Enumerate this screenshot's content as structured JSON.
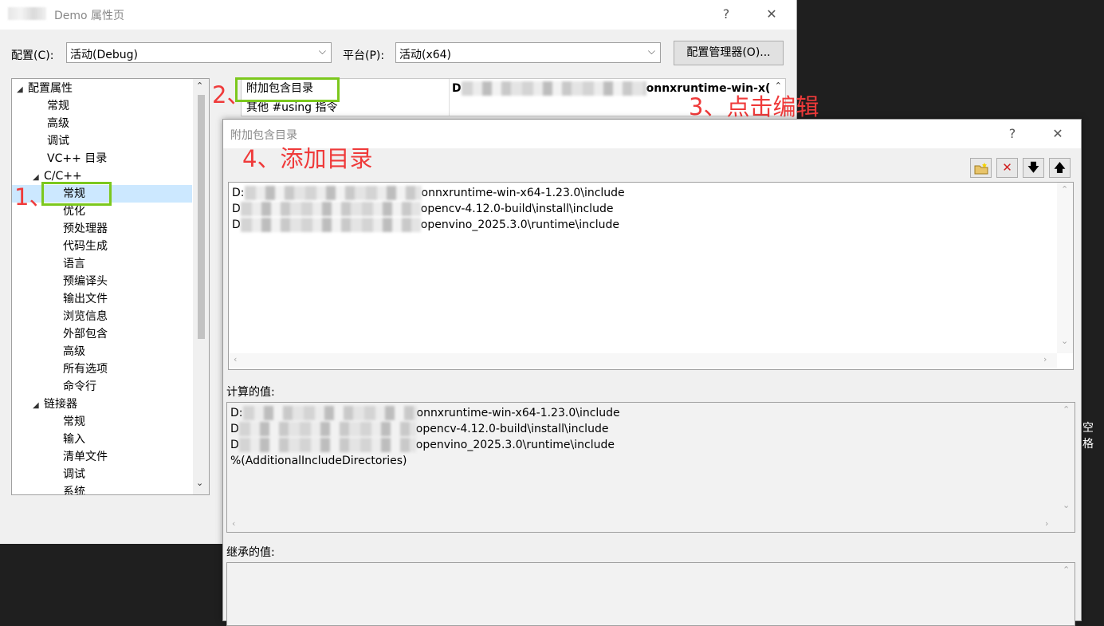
{
  "main_window": {
    "title": "Demo 属性页",
    "help": "?",
    "close": "✕",
    "config_label": "配置(C):",
    "config_value": "活动(Debug)",
    "platform_label": "平台(P):",
    "platform_value": "活动(x64)",
    "config_manager_button": "配置管理器(O)..."
  },
  "tree": {
    "items": [
      {
        "label": "配置属性",
        "expander": "◢"
      },
      {
        "label": "常规"
      },
      {
        "label": "高级"
      },
      {
        "label": "调试"
      },
      {
        "label": "VC++ 目录"
      },
      {
        "label": "C/C++",
        "expander": "◢"
      },
      {
        "label": "常规"
      },
      {
        "label": "优化"
      },
      {
        "label": "预处理器"
      },
      {
        "label": "代码生成"
      },
      {
        "label": "语言"
      },
      {
        "label": "预编译头"
      },
      {
        "label": "输出文件"
      },
      {
        "label": "浏览信息"
      },
      {
        "label": "外部包含"
      },
      {
        "label": "高级"
      },
      {
        "label": "所有选项"
      },
      {
        "label": "命令行"
      },
      {
        "label": "链接器",
        "expander": "◢"
      },
      {
        "label": "常规"
      },
      {
        "label": "输入"
      },
      {
        "label": "清单文件"
      },
      {
        "label": "调试"
      },
      {
        "label": "系统"
      }
    ]
  },
  "grid": {
    "row1_name": "附加包含目录",
    "row1_value_prefix": "D",
    "row1_value_suffix": "onnxruntime-win-x(",
    "row2_name": "其他 #using 指令"
  },
  "annotations": {
    "step1": "1、",
    "step2": "2、",
    "step3": "3、点击编辑",
    "step4": "4、添加目录"
  },
  "dialog": {
    "title": "附加包含目录",
    "help": "?",
    "close": "✕",
    "tool_icons": [
      "new-folder-icon",
      "delete-icon",
      "move-down-icon",
      "move-up-icon"
    ],
    "entries": [
      {
        "prefix": "D:",
        "suffix": "onnxruntime-win-x64-1.23.0\\include"
      },
      {
        "prefix": "D",
        "suffix": "opencv-4.12.0-build\\install\\include"
      },
      {
        "prefix": "D",
        "suffix": "openvino_2025.3.0\\runtime\\include"
      }
    ],
    "computed_label": "计算的值:",
    "computed": [
      {
        "prefix": "D:",
        "suffix": "onnxruntime-win-x64-1.23.0\\include"
      },
      {
        "prefix": "D",
        "suffix": "opencv-4.12.0-build\\install\\include"
      },
      {
        "prefix": "D",
        "suffix": "openvino_2025.3.0\\runtime\\include"
      },
      {
        "prefix": "",
        "suffix": "%(AdditionalIncludeDirectories)"
      }
    ],
    "inherited_label": "继承的值:"
  },
  "background_text": "空格"
}
